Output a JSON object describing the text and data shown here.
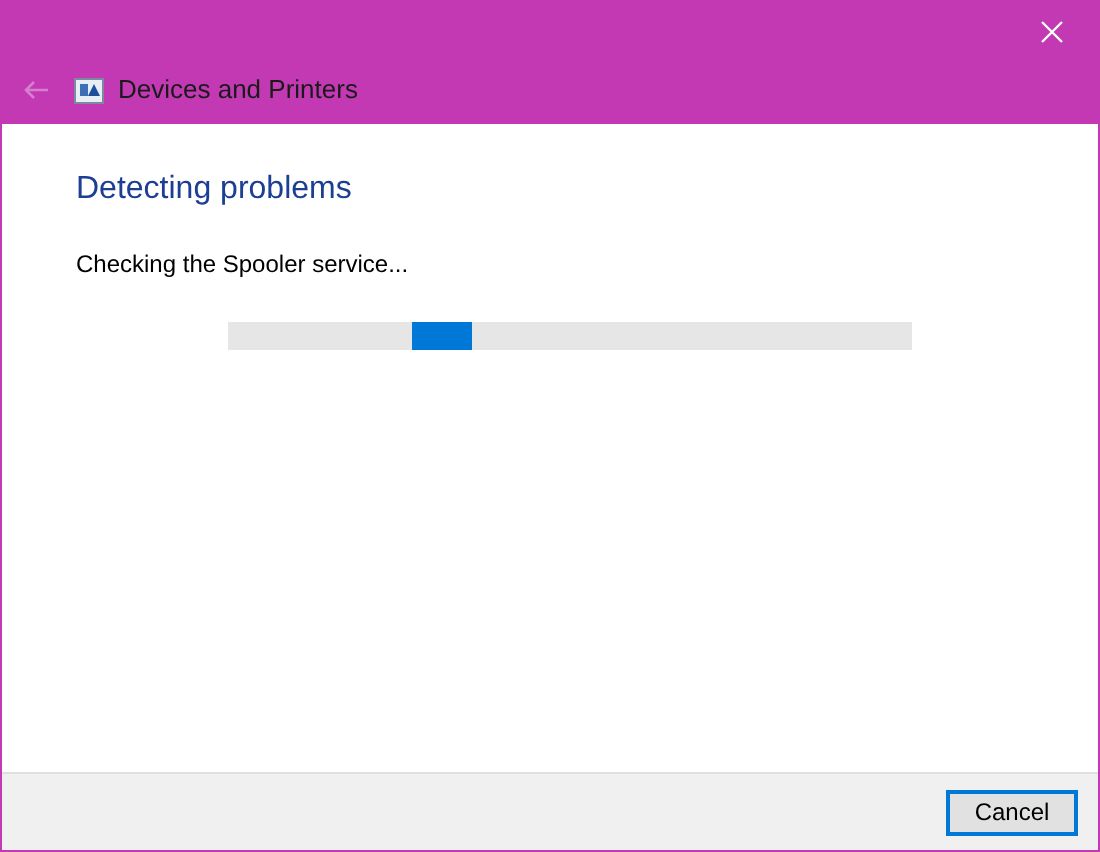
{
  "window": {
    "title": "Devices and Printers",
    "back_button": {
      "disabled": true
    }
  },
  "heading": "Detecting problems",
  "status": "Checking the Spooler service...",
  "progress": {
    "indeterminate": true
  },
  "buttons": [
    {
      "label": "Cancel",
      "default": true
    }
  ]
}
